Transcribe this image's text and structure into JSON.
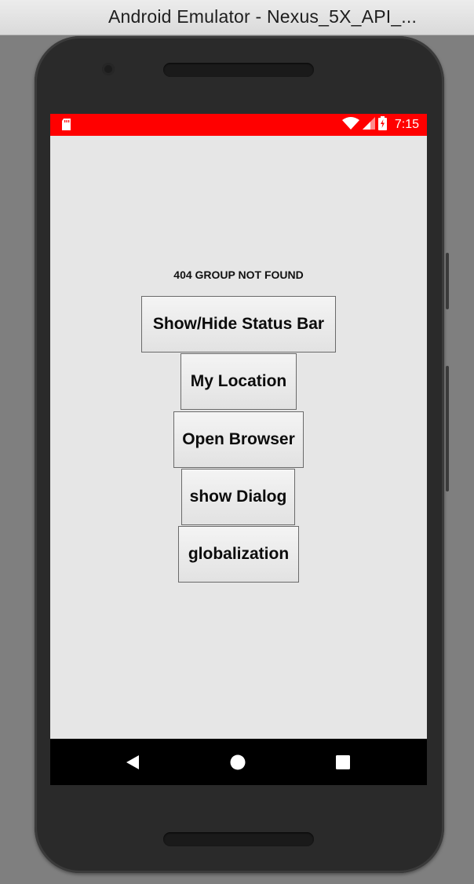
{
  "window": {
    "title": "Android Emulator - Nexus_5X_API_..."
  },
  "status_bar": {
    "time": "7:15",
    "background_color": "#ff0000",
    "icons": [
      "sd-card-icon",
      "wifi-icon",
      "signal-icon",
      "battery-charging-icon"
    ]
  },
  "app": {
    "heading": "404 GROUP NOT FOUND",
    "buttons": [
      {
        "label": "Show/Hide Status Bar"
      },
      {
        "label": "My Location"
      },
      {
        "label": "Open Browser"
      },
      {
        "label": "show Dialog"
      },
      {
        "label": "globalization"
      }
    ]
  },
  "nav_bar": {
    "icons": [
      "back-icon",
      "home-icon",
      "recents-icon"
    ]
  }
}
